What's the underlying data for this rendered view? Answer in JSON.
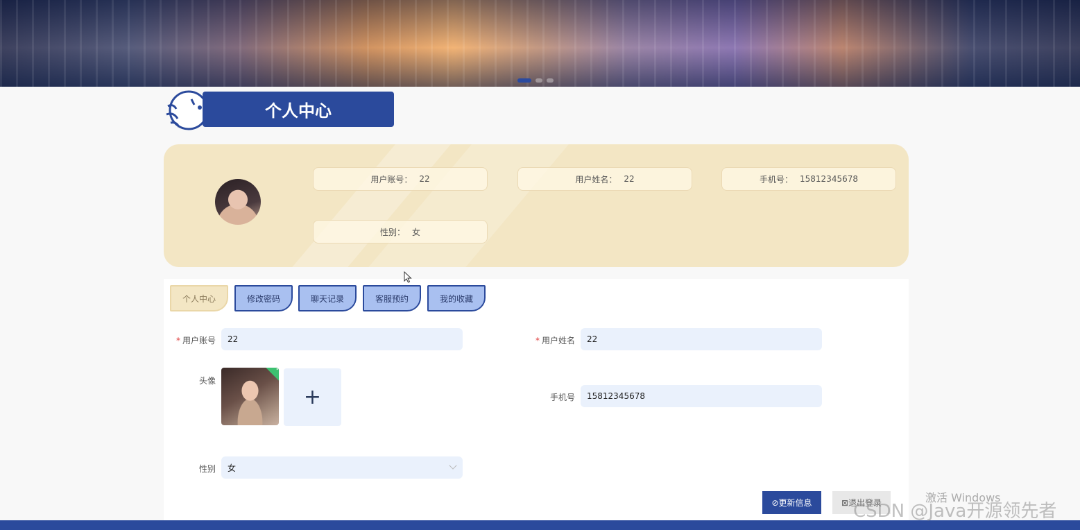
{
  "page": {
    "title": "个人中心"
  },
  "profile": {
    "account_label": "用户账号：",
    "account_value": "22",
    "name_label": "用户姓名：",
    "name_value": "22",
    "phone_label": "手机号：",
    "phone_value": "15812345678",
    "gender_label": "性别：",
    "gender_value": "女"
  },
  "tabs": [
    {
      "label": "个人中心",
      "active": true
    },
    {
      "label": "修改密码",
      "active": false
    },
    {
      "label": "聊天记录",
      "active": false
    },
    {
      "label": "客服预约",
      "active": false
    },
    {
      "label": "我的收藏",
      "active": false
    }
  ],
  "form": {
    "account_label": "用户账号",
    "account_value": "22",
    "name_label": "用户姓名",
    "name_value": "22",
    "avatar_label": "头像",
    "phone_label": "手机号",
    "phone_value": "15812345678",
    "gender_label": "性别",
    "gender_value": "女",
    "update_button": "⊘更新信息",
    "logout_button": "⊠退出登录"
  },
  "watermark": {
    "windows": "激活 Windows",
    "csdn": "CSDN @Java开源领先者"
  },
  "colors": {
    "primary": "#2b4a9c",
    "tab_inactive": "#a9c0f0",
    "card_bg": "#f3e6c4",
    "input_bg": "#eaf1fc"
  }
}
